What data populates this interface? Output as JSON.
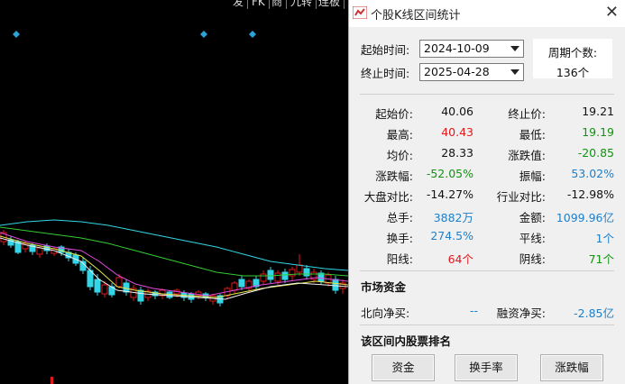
{
  "toolbar": {
    "tabs": [
      "发",
      "FK",
      "商",
      "九转",
      "连板"
    ]
  },
  "dialog": {
    "title": "个股K线区间统计",
    "close": "✕",
    "start_label": "起始时间:",
    "start_value": "2024-10-09",
    "end_label": "终止时间:",
    "end_value": "2025-04-28",
    "period_label": "周期个数:",
    "period_value": "136个"
  },
  "stats": {
    "start_price_label": "起始价:",
    "start_price": "40.06",
    "end_price_label": "终止价:",
    "end_price": "19.21",
    "high_label": "最高:",
    "high": "40.43",
    "low_label": "最低:",
    "low": "19.19",
    "avg_label": "均价:",
    "avg": "28.33",
    "change_val_label": "涨跌值:",
    "change_val": "-20.85",
    "change_pct_label": "涨跌幅:",
    "change_pct": "-52.05%",
    "amplitude_label": "振幅:",
    "amplitude": "53.02%",
    "vs_market_label": "大盘对比:",
    "vs_market": "-14.27%",
    "vs_industry_label": "行业对比:",
    "vs_industry": "-12.98%",
    "volume_label": "总手:",
    "volume": "3882万",
    "amount_label": "金额:",
    "amount": "1099.96亿",
    "turnover_label": "换手:",
    "turnover": "274.5%",
    "flat_label": "平线:",
    "flat": "1个",
    "up_label": "阳线:",
    "up": "64个",
    "down_label": "阴线:",
    "down": "71个"
  },
  "funds": {
    "title": "市场资金",
    "north_label": "北向净买:",
    "north": "--",
    "margin_label": "融资净买:",
    "margin": "-2.85亿"
  },
  "ranking": {
    "title": "该区间内股票排名",
    "btn_funds": "资金",
    "btn_turnover": "换手率",
    "btn_change": "涨跌幅"
  },
  "colors": {
    "up": "#e0191c",
    "down": "#109310",
    "neutral": "#1e7fc8",
    "ma_cyan": "#33d6e6",
    "ma_green": "#33cc33",
    "ma_magenta": "#e04be0",
    "ma_yellow": "#e6e64d",
    "ma_white": "#f0f0f0"
  }
}
